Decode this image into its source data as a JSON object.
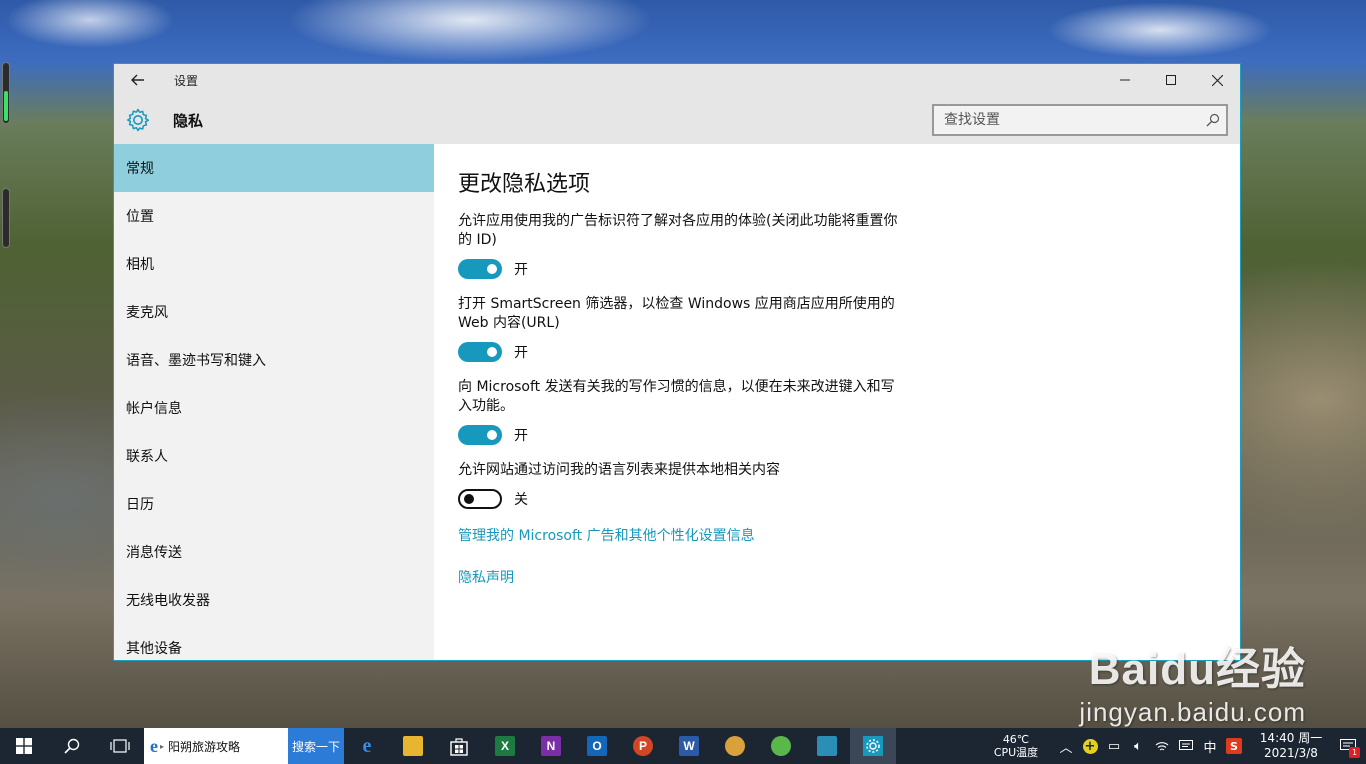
{
  "window": {
    "title": "设置",
    "page_name": "隐私",
    "search_placeholder": "查找设置"
  },
  "sidebar": {
    "items": [
      {
        "label": "常规",
        "active": true
      },
      {
        "label": "位置"
      },
      {
        "label": "相机"
      },
      {
        "label": "麦克风"
      },
      {
        "label": "语音、墨迹书写和键入"
      },
      {
        "label": "帐户信息"
      },
      {
        "label": "联系人"
      },
      {
        "label": "日历"
      },
      {
        "label": "消息传送"
      },
      {
        "label": "无线电收发器"
      },
      {
        "label": "其他设备"
      }
    ]
  },
  "content": {
    "heading": "更改隐私选项",
    "options": [
      {
        "desc": "允许应用使用我的广告标识符了解对各应用的体验(关闭此功能将重置你的 ID)",
        "state": "开",
        "on": true
      },
      {
        "desc": "打开 SmartScreen 筛选器，以检查 Windows 应用商店应用所使用的 Web 内容(URL)",
        "state": "开",
        "on": true
      },
      {
        "desc": "向 Microsoft 发送有关我的写作习惯的信息，以便在未来改进键入和写入功能。",
        "state": "开",
        "on": true
      },
      {
        "desc": "允许网站通过访问我的语言列表来提供本地相关内容",
        "state": "关",
        "on": false
      }
    ],
    "links": {
      "manage": "管理我的 Microsoft 广告和其他个性化设置信息",
      "privacy": "隐私声明"
    }
  },
  "taskbar": {
    "ie_tab": "阳朔旅游攻略",
    "search_button": "搜索一下",
    "apps": [
      {
        "icon": "edge-icon",
        "glyph": "e",
        "color": "#1f6fd0"
      },
      {
        "icon": "file-explorer-icon",
        "glyph": "",
        "color": "#e8b530"
      },
      {
        "icon": "store-icon",
        "glyph": "",
        "color": "#ffffff"
      },
      {
        "icon": "excel-icon",
        "glyph": "X",
        "color": "#1d7a43"
      },
      {
        "icon": "onenote-icon",
        "glyph": "N",
        "color": "#7a2fa6"
      },
      {
        "icon": "outlook-icon",
        "glyph": "O",
        "color": "#1466b8"
      },
      {
        "icon": "powerpoint-icon",
        "glyph": "P",
        "color": "#d24625"
      },
      {
        "icon": "word-icon",
        "glyph": "W",
        "color": "#2a5aa8"
      },
      {
        "icon": "paint-icon",
        "glyph": "",
        "color": "#d9a13a"
      },
      {
        "icon": "green-app-icon",
        "glyph": "",
        "color": "#5ab84a"
      },
      {
        "icon": "photos-icon",
        "glyph": "",
        "color": "#2b8fb5"
      },
      {
        "icon": "settings-icon",
        "glyph": "",
        "color": "#1798bd"
      }
    ],
    "temperature": "46℃",
    "temperature_label": "CPU温度",
    "ime": "中",
    "time": "14:40 周一",
    "date": "2021/3/8",
    "notification_count": "1"
  },
  "watermark": {
    "main": "Baidu经验",
    "sub": "jingyan.baidu.com"
  }
}
